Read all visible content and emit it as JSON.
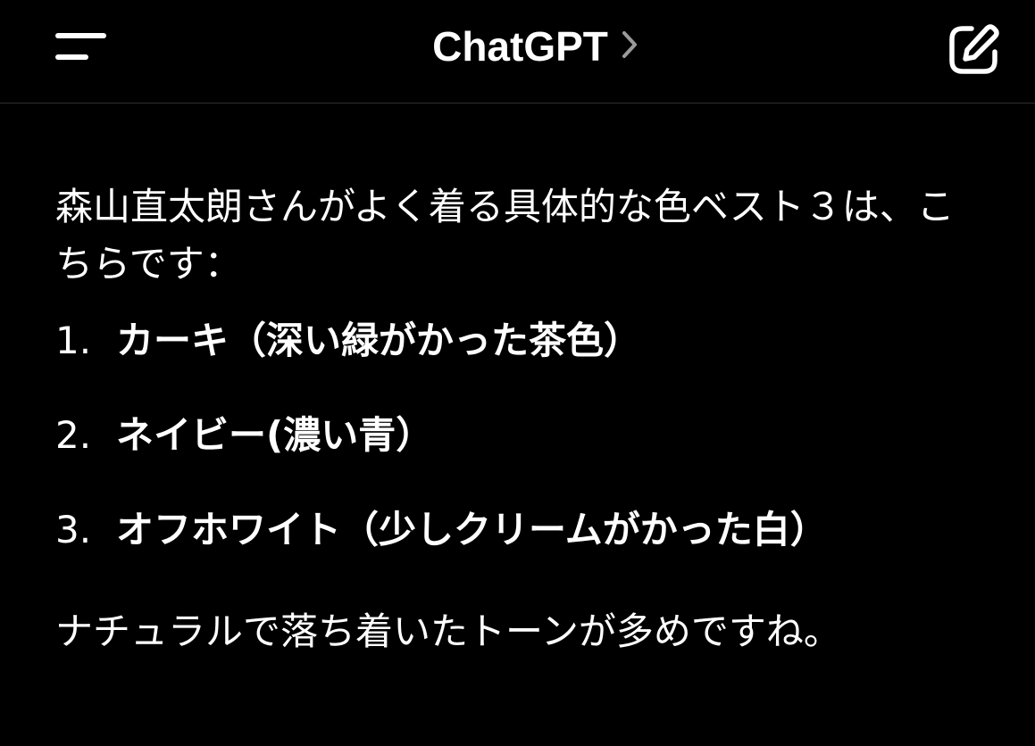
{
  "header": {
    "title": "ChatGPT",
    "menu_icon": "menu-icon",
    "chevron_icon": "chevron-right-icon",
    "new_chat_icon": "edit-icon"
  },
  "message": {
    "intro": "森山直太朗さんがよく着る具体的な色ベスト３は、こちらです：",
    "items": [
      {
        "num": "1.",
        "text": "カーキ（深い緑がかった茶色）"
      },
      {
        "num": "2.",
        "text": "ネイビー(濃い青）"
      },
      {
        "num": "3.",
        "text": "オフホワイト（少しクリームがかった白）"
      }
    ],
    "outro": "ナチュラルで落ち着いたトーンが多めですね。"
  },
  "colors": {
    "background": "#000000",
    "text": "#ffffff",
    "divider": "#2f2f2f",
    "chevron": "#9a9a9a"
  }
}
